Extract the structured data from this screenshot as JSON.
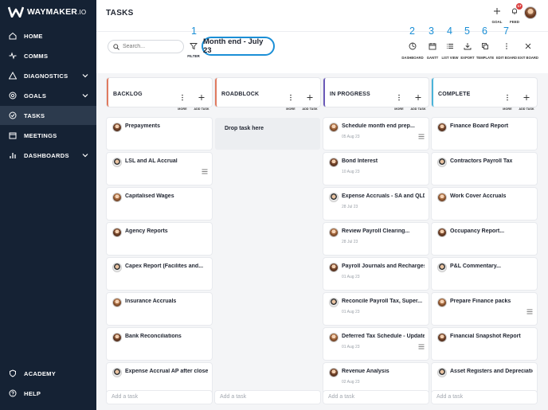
{
  "brand": {
    "name": "WAYMAKER",
    "suffix": ".IO"
  },
  "sidebar": {
    "items": [
      {
        "label": "HOME",
        "icon": "home-icon"
      },
      {
        "label": "COMMS",
        "icon": "pulse-icon"
      },
      {
        "label": "DIAGNOSTICS",
        "icon": "warning-icon",
        "expandable": true
      },
      {
        "label": "GOALS",
        "icon": "target-icon",
        "expandable": true
      },
      {
        "label": "TASKS",
        "icon": "check-circle-icon",
        "active": true
      },
      {
        "label": "MEETINGS",
        "icon": "calendar-icon"
      },
      {
        "label": "DASHBOARDS",
        "icon": "bar-chart-icon",
        "expandable": true
      }
    ],
    "bottom": [
      {
        "label": "ACADEMY",
        "icon": "shield-icon"
      },
      {
        "label": "HELP",
        "icon": "help-icon"
      }
    ]
  },
  "header": {
    "title": "TASKS",
    "goal_label": "GOAL",
    "feed_label": "FEED",
    "feed_badge": "17"
  },
  "toolbar": {
    "search_placeholder": "Search...",
    "filter_label": "FILTER",
    "board_name": "Month end - July 23",
    "buttons": [
      {
        "label": "DASHBOARD",
        "num": "2"
      },
      {
        "label": "GANTT",
        "num": "3"
      },
      {
        "label": "LIST VIEW",
        "num": "4"
      },
      {
        "label": "EXPORT",
        "num": "5"
      },
      {
        "label": "TEMPLATE",
        "num": "6"
      },
      {
        "label": "EDIT BOARD",
        "num": "7"
      },
      {
        "label": "EXIT BOARD",
        "num": ""
      }
    ],
    "filter_num": "1"
  },
  "board": {
    "more_label": "MORE",
    "add_label": "ADD TASK",
    "add_task_placeholder": "Add a task",
    "drop_text": "Drop task here",
    "columns": [
      {
        "title": "BACKLOG",
        "accent": "#e07a5f",
        "cards": [
          {
            "title": "Prepayments",
            "date": ""
          },
          {
            "title": "LSL and AL Accrual",
            "date": "",
            "menu": true
          },
          {
            "title": "Capitalised Wages",
            "date": ""
          },
          {
            "title": "Agency Reports",
            "date": ""
          },
          {
            "title": "Capex Report (Facilites and...",
            "date": ""
          },
          {
            "title": "Insurance Accruals",
            "date": ""
          },
          {
            "title": "Bank Reconciliations",
            "date": ""
          },
          {
            "title": "Expense Accrual AP after close...",
            "date": ""
          }
        ]
      },
      {
        "title": "ROADBLOCK",
        "accent": "#e07a5f",
        "cards": []
      },
      {
        "title": "IN PROGRESS",
        "accent": "#6b5ab8",
        "cards": [
          {
            "title": "Schedule month end prep...",
            "date": "05 Aug 23",
            "menu": true
          },
          {
            "title": "Bond Interest",
            "date": "10 Aug 23"
          },
          {
            "title": "Expense Accruals - SA and QLD",
            "date": "28 Jul 23"
          },
          {
            "title": "Review Payroll Clearing...",
            "date": "28 Jul 23"
          },
          {
            "title": "Payroll Journals and Recharges",
            "date": "01 Aug 23"
          },
          {
            "title": "Reconcile Payroll Tax, Super...",
            "date": "01 Aug 23"
          },
          {
            "title": "Deferred Tax Schedule - Update...",
            "date": "01 Aug 23",
            "menu": true
          },
          {
            "title": "Revenue Analysis",
            "date": "02 Aug 23"
          }
        ]
      },
      {
        "title": "COMPLETE",
        "accent": "#4ab3d9",
        "cards": [
          {
            "title": "Finance Board Report",
            "date": ""
          },
          {
            "title": "Contractors Payroll Tax",
            "date": ""
          },
          {
            "title": "Work Cover Accruals",
            "date": ""
          },
          {
            "title": "Occupancy Report...",
            "date": ""
          },
          {
            "title": "P&L Commentary...",
            "date": ""
          },
          {
            "title": "Prepare Finance packs",
            "date": "",
            "menu": true
          },
          {
            "title": "Financial Snapshot Report",
            "date": ""
          },
          {
            "title": "Asset Registers and Depreciation",
            "date": ""
          }
        ]
      }
    ]
  },
  "colors": {
    "sidebar": "#152234",
    "accent_blue": "#1b8fd6",
    "badge_red": "#d93d3d"
  }
}
